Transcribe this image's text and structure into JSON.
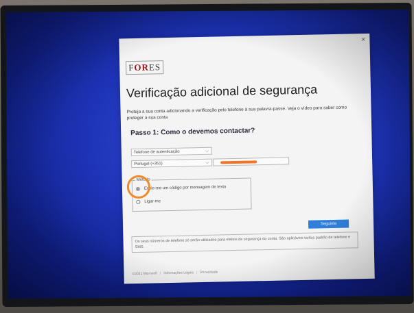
{
  "dialog": {
    "logo": {
      "prefix": "F",
      "accent": "OR",
      "suffix": "ES"
    },
    "close_glyph": "×",
    "title": "Verificação adicional de segurança",
    "intro": "Proteja a sua conta adicionando a verificação pelo telefone à sua palavra-passe. Veja o vídeo para saber como proteger a sua conta",
    "step_title": "Passo 1: Como o devemos contactar?",
    "contact_method_select": {
      "value": "Telefone de autenticação"
    },
    "country_select": {
      "value": "Portugal (+351)"
    },
    "method": {
      "legend": "Método",
      "options": [
        {
          "label": "Envie-me um código por mensagem de texto",
          "selected": true
        },
        {
          "label": "Ligar-me",
          "selected": false
        }
      ]
    },
    "next_button": "Seguinte",
    "notice": "Os seus números de telefone só serão utilizados para efeitos de segurança da conta. São aplicáveis tarifas padrão de telefone e SMS.",
    "footer": {
      "copyright": "©2021 Microsoft",
      "legal": "Informações Legais",
      "privacy": "Privacidade",
      "separator": "|"
    }
  },
  "colors": {
    "accent_blue": "#2f7ed8",
    "highlight_orange": "#f28a2a",
    "redaction": "#f27428",
    "logo_red": "#a0171d"
  }
}
